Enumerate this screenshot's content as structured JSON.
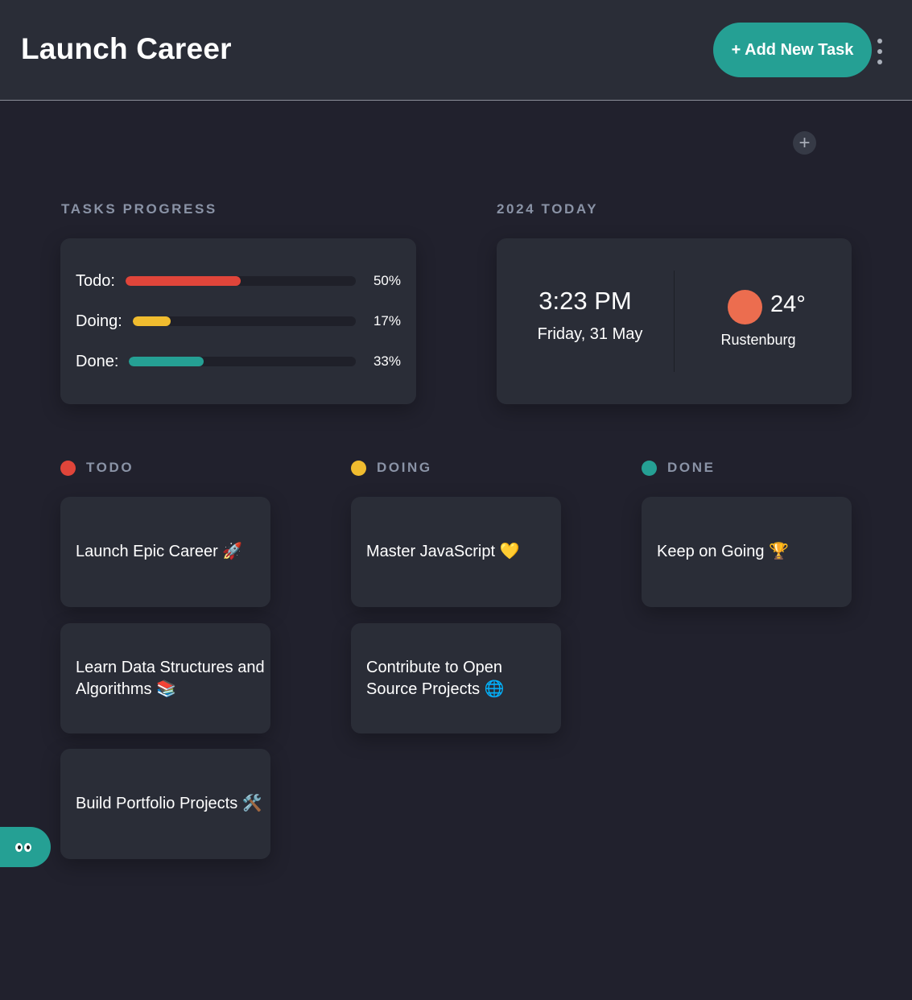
{
  "header": {
    "title": "Launch Career",
    "add_task_label": "+ Add New Task",
    "menu_icon": "kebab-menu-icon"
  },
  "add_widget_icon": "+",
  "progress": {
    "section_label": "TASKS PROGRESS",
    "rows": [
      {
        "label": "Todo:",
        "percent_text": "50%",
        "fraction": 0.5,
        "color": "#e0453a"
      },
      {
        "label": "Doing:",
        "percent_text": "17%",
        "fraction": 0.17,
        "color": "#f0bc2f"
      },
      {
        "label": "Done:",
        "percent_text": "33%",
        "fraction": 0.33,
        "color": "#25a094"
      }
    ]
  },
  "today": {
    "section_label": "2024 TODAY",
    "time": "3:23 PM",
    "date": "Friday, 31 May",
    "temperature": "24°",
    "city": "Rustenburg",
    "weather_icon": "sun-icon",
    "sun_color": "#ec6d4f"
  },
  "columns": [
    {
      "title": "TODO",
      "color": "#e0453a",
      "tasks": [
        {
          "text": "Launch Epic Career 🚀"
        },
        {
          "text": "Learn Data Structures and Algorithms 📚"
        },
        {
          "text": "Build Portfolio Projects 🛠️"
        }
      ]
    },
    {
      "title": "DOING",
      "color": "#f0bc2f",
      "tasks": [
        {
          "text": "Master JavaScript 💛"
        },
        {
          "text": "Contribute to Open Source Projects 🌐"
        }
      ]
    },
    {
      "title": "DONE",
      "color": "#25a094",
      "tasks": [
        {
          "text": "Keep on Going 🏆"
        }
      ]
    }
  ],
  "fab_icon": "eyes-icon",
  "colors": {
    "background": "#21212d",
    "card": "#2a2d37",
    "accent": "#25a094"
  }
}
